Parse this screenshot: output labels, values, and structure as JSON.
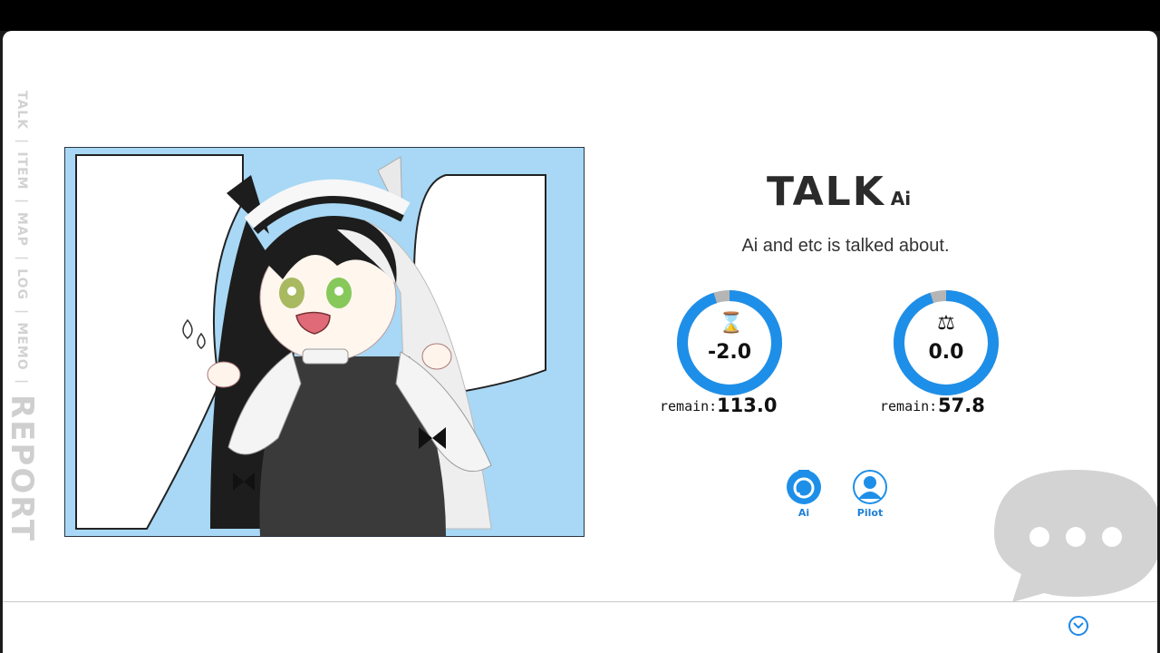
{
  "side_nav": {
    "items": [
      "TALK",
      "ITEM",
      "MAP",
      "LOG",
      "MEMO"
    ],
    "separator": "|",
    "active": "REPORT"
  },
  "talk": {
    "title": "TALK",
    "subject": "Ai",
    "description": "Ai and etc is talked about."
  },
  "gauges": [
    {
      "icon": "hourglass-icon",
      "glyph": "⌛",
      "value": "-2.0",
      "remain_label": "remain:",
      "remain_value": "113.0",
      "fill_fraction": 0.95
    },
    {
      "icon": "scale-icon",
      "glyph": "⚖",
      "value": "0.0",
      "remain_label": "remain:",
      "remain_value": "57.8",
      "fill_fraction": 0.95
    }
  ],
  "characters": [
    {
      "label": "Ai",
      "icon": "ai-icon"
    },
    {
      "label": "Pilot",
      "icon": "pilot-icon"
    }
  ],
  "colors": {
    "accent": "#1e8fe8",
    "gauge_track": "#b5b5b5",
    "scene_bg": "#a8d8f5",
    "nav_text": "#d2d2d2"
  }
}
